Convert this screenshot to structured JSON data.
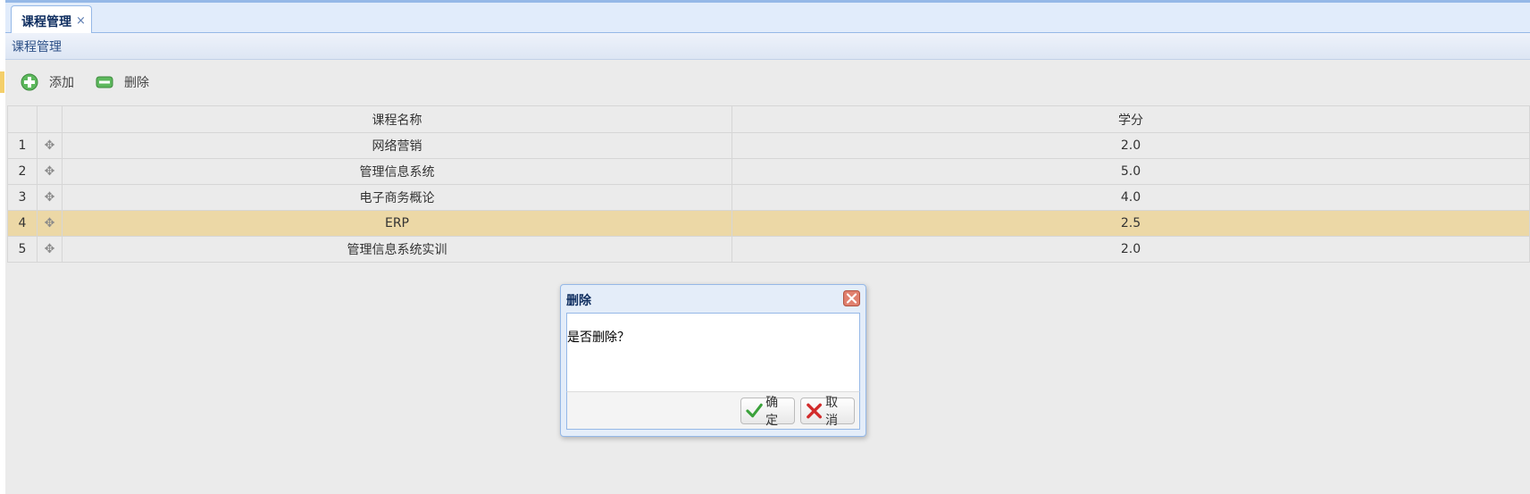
{
  "tabs": [
    {
      "label": "课程管理",
      "close": "×"
    }
  ],
  "panel": {
    "title": "课程管理"
  },
  "toolbar": {
    "add_label": "添加",
    "delete_label": "删除"
  },
  "grid": {
    "columns": [
      "课程名称",
      "学分"
    ],
    "rows": [
      {
        "num": "1",
        "name": "网络营销",
        "credit": "2.0"
      },
      {
        "num": "2",
        "name": "管理信息系统",
        "credit": "5.0"
      },
      {
        "num": "3",
        "name": "电子商务概论",
        "credit": "4.0"
      },
      {
        "num": "4",
        "name": "ERP",
        "credit": "2.5",
        "selected": true
      },
      {
        "num": "5",
        "name": "管理信息系统实训",
        "credit": "2.0"
      }
    ]
  },
  "dialog": {
    "title": "删除",
    "message": "是否删除？",
    "ok_label": "确定",
    "cancel_label": "取消"
  },
  "colors": {
    "accent": "#95b8e7",
    "selected_row": "#ecd8a6",
    "ok_green": "#3aa13a",
    "cancel_red": "#d22c2c"
  },
  "icons": {
    "add": "plus-circle-icon",
    "delete": "minus-rect-icon",
    "expand": "plus-icon",
    "close": "close-icon"
  }
}
